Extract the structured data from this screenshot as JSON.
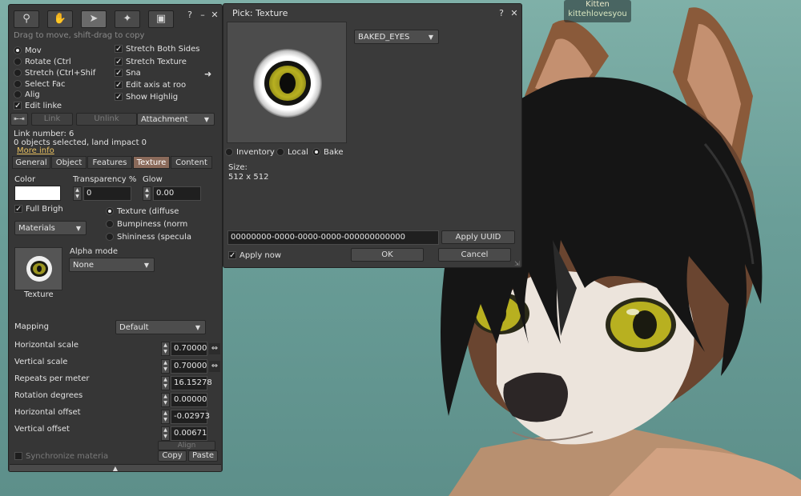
{
  "avatar": {
    "name": "Kitten",
    "username": "kittehlovesyou"
  },
  "tools": {
    "tool_icons": [
      "magnifier-icon",
      "grab-hand-icon",
      "cursor-arrow-icon",
      "magic-wand-icon",
      "bulldozer-icon"
    ],
    "help_label": "?",
    "minimize_label": "–",
    "close_label": "✕",
    "hint": "Drag to move, shift-drag to copy",
    "modes": [
      {
        "label": "Mov",
        "selected": true
      },
      {
        "label": "Rotate (Ctrl",
        "selected": false
      },
      {
        "label": "Stretch (Ctrl+Shif",
        "selected": false
      },
      {
        "label": "Select Fac",
        "selected": false
      },
      {
        "label": "Alig",
        "selected": false
      }
    ],
    "edit_linked": {
      "label": "Edit linke",
      "checked": true
    },
    "options": [
      {
        "label": "Stretch Both Sides",
        "checked": true
      },
      {
        "label": "Stretch Texture",
        "checked": true
      },
      {
        "label": "Sna",
        "checked": true
      },
      {
        "label": "Edit axis at roo",
        "checked": true
      },
      {
        "label": "Show Highlig",
        "checked": true
      }
    ],
    "link_label": "Link",
    "unlink_label": "Unlink",
    "attachment_label": "Attachment",
    "link_number": "Link number: 6",
    "selection_info": "0 objects selected, land impact 0",
    "more_info": "More info",
    "tabs": [
      "General",
      "Object",
      "Features",
      "Texture",
      "Content"
    ],
    "active_tab": "Texture",
    "color_label": "Color",
    "color_value": "#ffffff",
    "transparency_label": "Transparency %",
    "transparency_value": "0",
    "glow_label": "Glow",
    "glow_value": "0.00",
    "full_bright": {
      "label": "Full Brigh",
      "checked": true
    },
    "materials_label": "Materials",
    "map_types": [
      {
        "label": "Texture (diffuse",
        "selected": true
      },
      {
        "label": "Bumpiness (norm",
        "selected": false
      },
      {
        "label": "Shininess (specula",
        "selected": false
      }
    ],
    "alpha_mode_label": "Alpha mode",
    "alpha_mode_value": "None",
    "texture_label": "Texture",
    "mapping_label": "Mapping",
    "mapping_value": "Default",
    "params": [
      {
        "label": "Horizontal scale",
        "value": "0.70000",
        "flip": true
      },
      {
        "label": "Vertical scale",
        "value": "0.70000",
        "flip": true
      },
      {
        "label": "Repeats per meter",
        "value": "16.15278",
        "flip": false
      },
      {
        "label": "Rotation degrees",
        "value": "0.00000",
        "flip": false
      },
      {
        "label": "Horizontal offset",
        "value": "-0.02973",
        "flip": false
      },
      {
        "label": "Vertical offset",
        "value": "0.00671",
        "flip": false
      }
    ],
    "align_label": "Align",
    "sync_materials": {
      "label": "Synchronize materia",
      "checked": false
    },
    "copy_label": "Copy",
    "paste_label": "Paste"
  },
  "picker": {
    "title": "Pick: Texture",
    "help_label": "?",
    "close_label": "✕",
    "source_dropdown": "BAKED_EYES",
    "sources": [
      {
        "label": "Inventory",
        "selected": false
      },
      {
        "label": "Local",
        "selected": false
      },
      {
        "label": "Bake",
        "selected": true
      }
    ],
    "size_label": "Size:",
    "size_value": "512 x 512",
    "uuid": "00000000-0000-0000-0000-000000000000",
    "apply_uuid_label": "Apply UUID",
    "apply_now": {
      "label": "Apply now",
      "checked": true
    },
    "ok_label": "OK",
    "cancel_label": "Cancel"
  },
  "colors": {
    "panel": "#363636",
    "active_tab": "#8a6a5a",
    "link": "#e8c060",
    "eye_iris": "#b8b020"
  }
}
